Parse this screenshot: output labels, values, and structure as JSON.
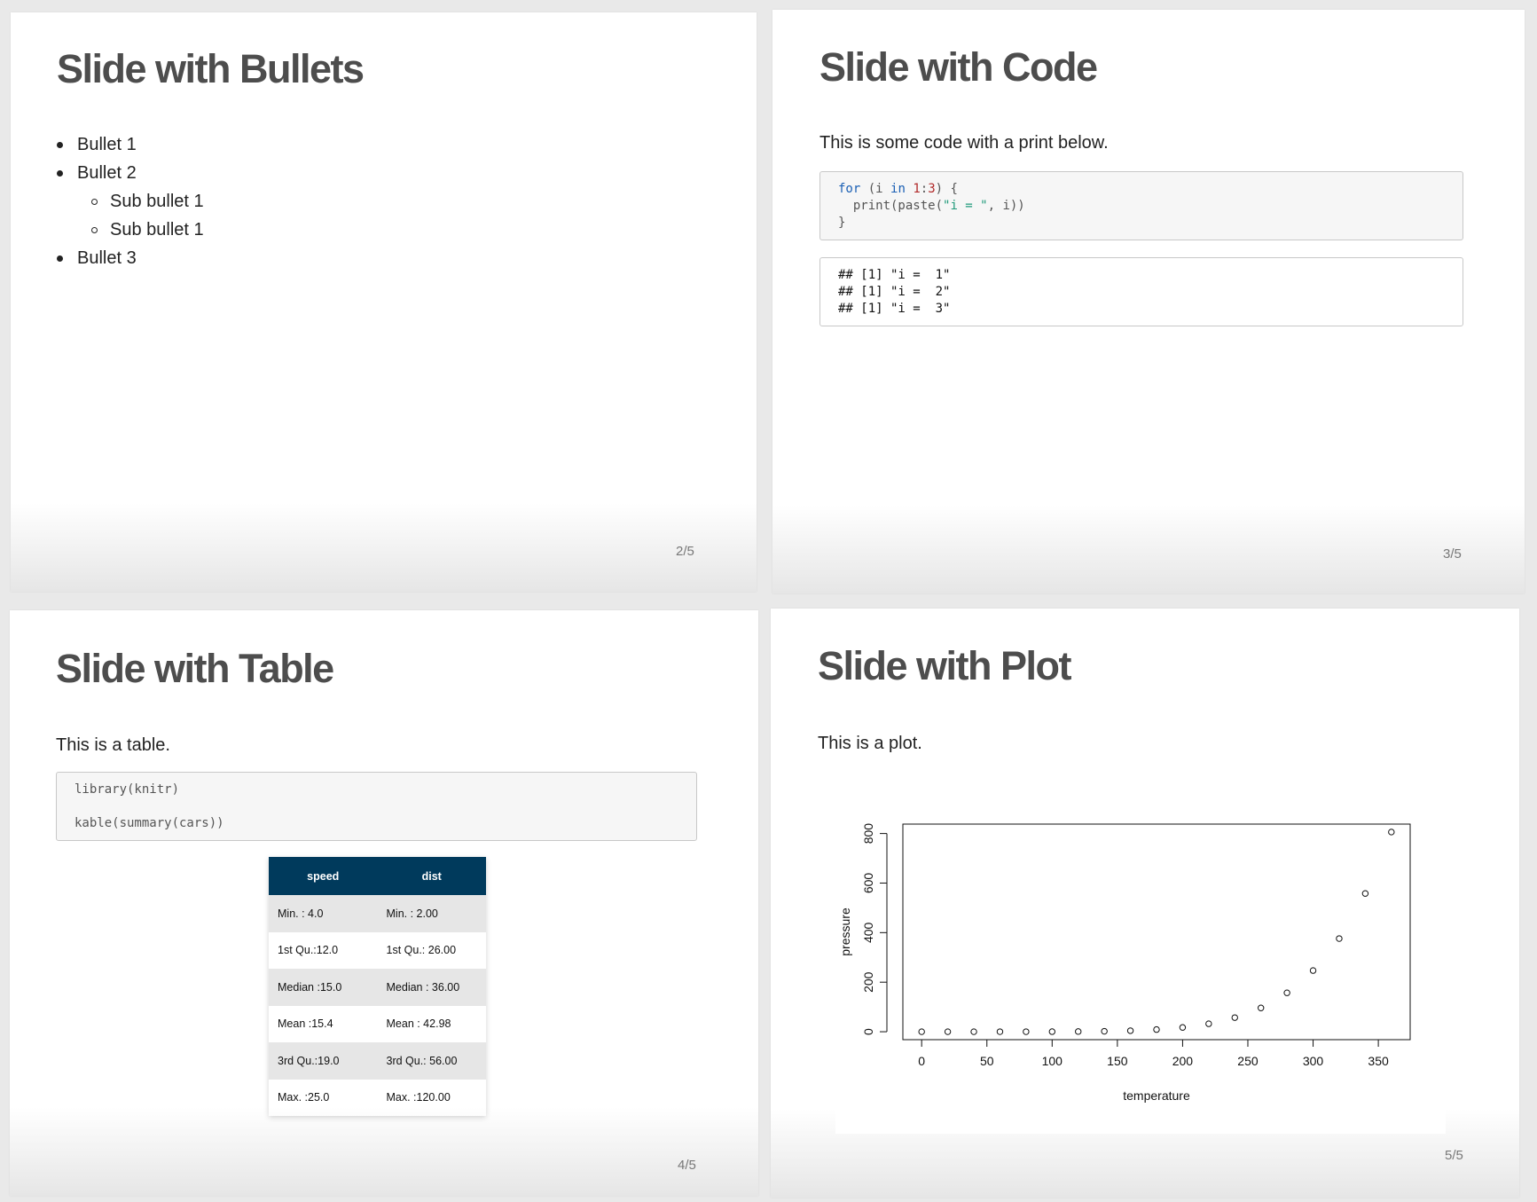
{
  "slides": [
    {
      "title": "Slide with Bullets",
      "bullets": [
        "Bullet 1",
        "Bullet 2",
        "Sub bullet 1",
        "Sub bullet 1",
        "Bullet 3"
      ],
      "page": "2/5"
    },
    {
      "title": "Slide with Code",
      "text": "This is some code with a print below.",
      "code_lines": [
        "for (i in 1:3) {",
        "  print(paste(\"i = \", i))",
        "}"
      ],
      "output_lines": [
        "## [1] \"i =  1\"",
        "## [1] \"i =  2\"",
        "## [1] \"i =  3\""
      ],
      "page": "3/5"
    },
    {
      "title": "Slide with Table",
      "text": "This is a table.",
      "code_lines": [
        "library(knitr)",
        "",
        "kable(summary(cars))"
      ],
      "table": {
        "headers": [
          "speed",
          "dist"
        ],
        "rows": [
          [
            "Min. : 4.0",
            "Min. : 2.00"
          ],
          [
            "1st Qu.:12.0",
            "1st Qu.: 26.00"
          ],
          [
            "Median :15.0",
            "Median : 36.00"
          ],
          [
            "Mean :15.4",
            "Mean : 42.98"
          ],
          [
            "3rd Qu.:19.0",
            "3rd Qu.: 56.00"
          ],
          [
            "Max. :25.0",
            "Max. :120.00"
          ]
        ]
      },
      "page": "4/5"
    },
    {
      "title": "Slide with Plot",
      "text": "This is a plot.",
      "page": "5/5"
    }
  ],
  "chart_data": {
    "type": "scatter",
    "xlabel": "temperature",
    "ylabel": "pressure",
    "x": [
      0,
      20,
      40,
      60,
      80,
      100,
      120,
      140,
      160,
      180,
      200,
      220,
      240,
      260,
      280,
      300,
      320,
      340,
      360
    ],
    "y": [
      0.0002,
      0.0012,
      0.006,
      0.03,
      0.09,
      0.27,
      0.75,
      1.85,
      4.2,
      8.8,
      17.3,
      32.1,
      57,
      96,
      157,
      247,
      376,
      558,
      806
    ],
    "xticks": [
      0,
      50,
      100,
      150,
      200,
      250,
      300,
      350
    ],
    "yticks": [
      0,
      200,
      400,
      600,
      800
    ],
    "xlim": [
      -14.4,
      374.4
    ],
    "ylim": [
      -32,
      838
    ],
    "grid": false
  }
}
